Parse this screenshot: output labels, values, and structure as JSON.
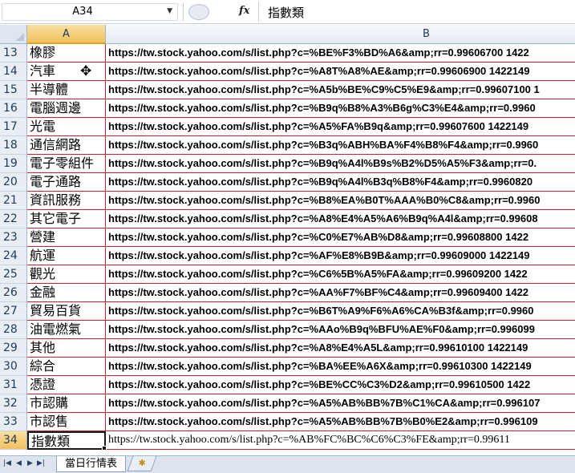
{
  "formula_bar": {
    "name_box": "A34",
    "fx_label": "fx",
    "formula": "指數類"
  },
  "columns": {
    "a": "A",
    "b": "B"
  },
  "rows": [
    {
      "num": "13",
      "a": "橡膠",
      "b": "https://tw.stock.yahoo.com/s/list.php?c=%BE%F3%BD%A6&amp;rr=0.99606700 1422"
    },
    {
      "num": "14",
      "a": "汽車",
      "b": "https://tw.stock.yahoo.com/s/list.php?c=%A8T%A8%AE&amp;rr=0.99606900 1422149"
    },
    {
      "num": "15",
      "a": "半導體",
      "b": "https://tw.stock.yahoo.com/s/list.php?c=%A5b%BE%C9%C5%E9&amp;rr=0.99607100 1"
    },
    {
      "num": "16",
      "a": "電腦週邊",
      "b": "https://tw.stock.yahoo.com/s/list.php?c=%B9q%B8%A3%B6g%C3%E4&amp;rr=0.9960"
    },
    {
      "num": "17",
      "a": "光電",
      "b": "https://tw.stock.yahoo.com/s/list.php?c=%A5%FA%B9q&amp;rr=0.99607600 1422149"
    },
    {
      "num": "18",
      "a": "通信網路",
      "b": "https://tw.stock.yahoo.com/s/list.php?c=%B3q%ABH%BA%F4%B8%F4&amp;rr=0.9960"
    },
    {
      "num": "19",
      "a": "電子零組件",
      "b": "https://tw.stock.yahoo.com/s/list.php?c=%B9q%A4l%B9s%B2%D5%A5%F3&amp;rr=0."
    },
    {
      "num": "20",
      "a": "電子通路",
      "b": "https://tw.stock.yahoo.com/s/list.php?c=%B9q%A4l%B3q%B8%F4&amp;rr=0.9960820"
    },
    {
      "num": "21",
      "a": "資訊服務",
      "b": "https://tw.stock.yahoo.com/s/list.php?c=%B8%EA%B0T%AAA%B0%C8&amp;rr=0.9960"
    },
    {
      "num": "22",
      "a": "其它電子",
      "b": "https://tw.stock.yahoo.com/s/list.php?c=%A8%E4%A5%A6%B9q%A4l&amp;rr=0.99608"
    },
    {
      "num": "23",
      "a": "營建",
      "b": "https://tw.stock.yahoo.com/s/list.php?c=%C0%E7%AB%D8&amp;rr=0.99608800 1422"
    },
    {
      "num": "24",
      "a": "航運",
      "b": "https://tw.stock.yahoo.com/s/list.php?c=%AF%E8%B9B&amp;rr=0.99609000 1422149"
    },
    {
      "num": "25",
      "a": "觀光",
      "b": "https://tw.stock.yahoo.com/s/list.php?c=%C6%5B%A5%FA&amp;rr=0.99609200 1422"
    },
    {
      "num": "26",
      "a": "金融",
      "b": "https://tw.stock.yahoo.com/s/list.php?c=%AA%F7%BF%C4&amp;rr=0.99609400 1422"
    },
    {
      "num": "27",
      "a": "貿易百貨",
      "b": "https://tw.stock.yahoo.com/s/list.php?c=%B6T%A9%F6%A6%CA%B3f&amp;rr=0.9960"
    },
    {
      "num": "28",
      "a": "油電燃氣",
      "b": "https://tw.stock.yahoo.com/s/list.php?c=%AAo%B9q%BFU%AE%F0&amp;rr=0.996099"
    },
    {
      "num": "29",
      "a": "其他",
      "b": "https://tw.stock.yahoo.com/s/list.php?c=%A8%E4%A5L&amp;rr=0.99610100 1422149"
    },
    {
      "num": "30",
      "a": "綜合",
      "b": "https://tw.stock.yahoo.com/s/list.php?c=%BA%EE%A6X&amp;rr=0.99610300 1422149"
    },
    {
      "num": "31",
      "a": "憑證",
      "b": "https://tw.stock.yahoo.com/s/list.php?c=%BE%CC%C3%D2&amp;rr=0.99610500 1422"
    },
    {
      "num": "32",
      "a": "市認購",
      "b": "https://tw.stock.yahoo.com/s/list.php?c=%A5%AB%BB%7B%C1%CA&amp;rr=0.996107"
    },
    {
      "num": "33",
      "a": "市認售",
      "b": "https://tw.stock.yahoo.com/s/list.php?c=%A5%AB%BB%7B%B0%E2&amp;rr=0.996109"
    },
    {
      "num": "34",
      "a": "指數類",
      "b": "https://tw.stock.yahoo.com/s/list.php?c=%AB%FC%BC%C6%C3%FE&amp;rr=0.99611"
    }
  ],
  "sheet_tabs": {
    "active": "當日行情表"
  },
  "colors": {
    "grid_border": "#d5202a",
    "active_header": "#f1c15f"
  }
}
